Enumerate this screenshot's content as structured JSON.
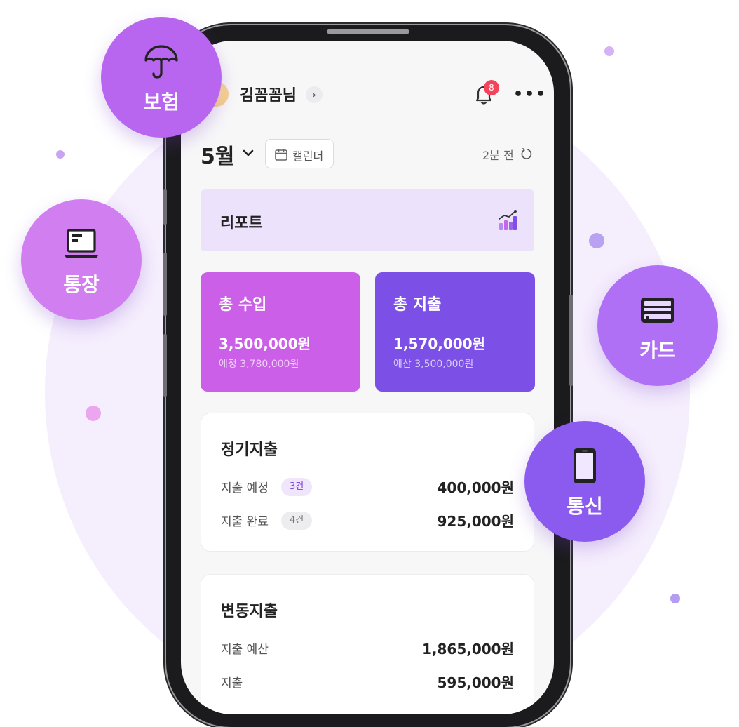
{
  "header": {
    "username": "김꼼꼼님",
    "notification_count": "8",
    "more_label": "•••"
  },
  "period": {
    "month": "5월",
    "calendar_label": "캘린더",
    "updated": "2분 전"
  },
  "report": {
    "title": "리포트"
  },
  "summary": {
    "income": {
      "title": "총 수입",
      "amount": "3,500,000원",
      "sub": "예정 3,780,000원",
      "color": "#cc5fe8"
    },
    "expense": {
      "title": "총 지출",
      "amount": "1,570,000원",
      "sub": "예산 3,500,000원",
      "color": "#7c4fe6"
    }
  },
  "regular": {
    "title": "정기지출",
    "rows": [
      {
        "label": "지출 예정",
        "count": "3건",
        "value": "400,000원"
      },
      {
        "label": "지출 완료",
        "count": "4건",
        "value": "925,000원"
      }
    ]
  },
  "variable": {
    "title": "변동지출",
    "rows": [
      {
        "label": "지출 예산",
        "value": "1,865,000원"
      },
      {
        "label": "지출",
        "value": "595,000원"
      }
    ]
  },
  "bubbles": {
    "insurance": {
      "label": "보험",
      "icon": "umbrella-icon",
      "color": "#b866ef"
    },
    "bank": {
      "label": "통장",
      "icon": "laptop-icon",
      "color": "#d17ef0"
    },
    "card": {
      "label": "카드",
      "icon": "credit-card-icon",
      "color": "#b070f5"
    },
    "telecom": {
      "label": "통신",
      "icon": "smartphone-icon",
      "color": "#8b5aee"
    }
  }
}
